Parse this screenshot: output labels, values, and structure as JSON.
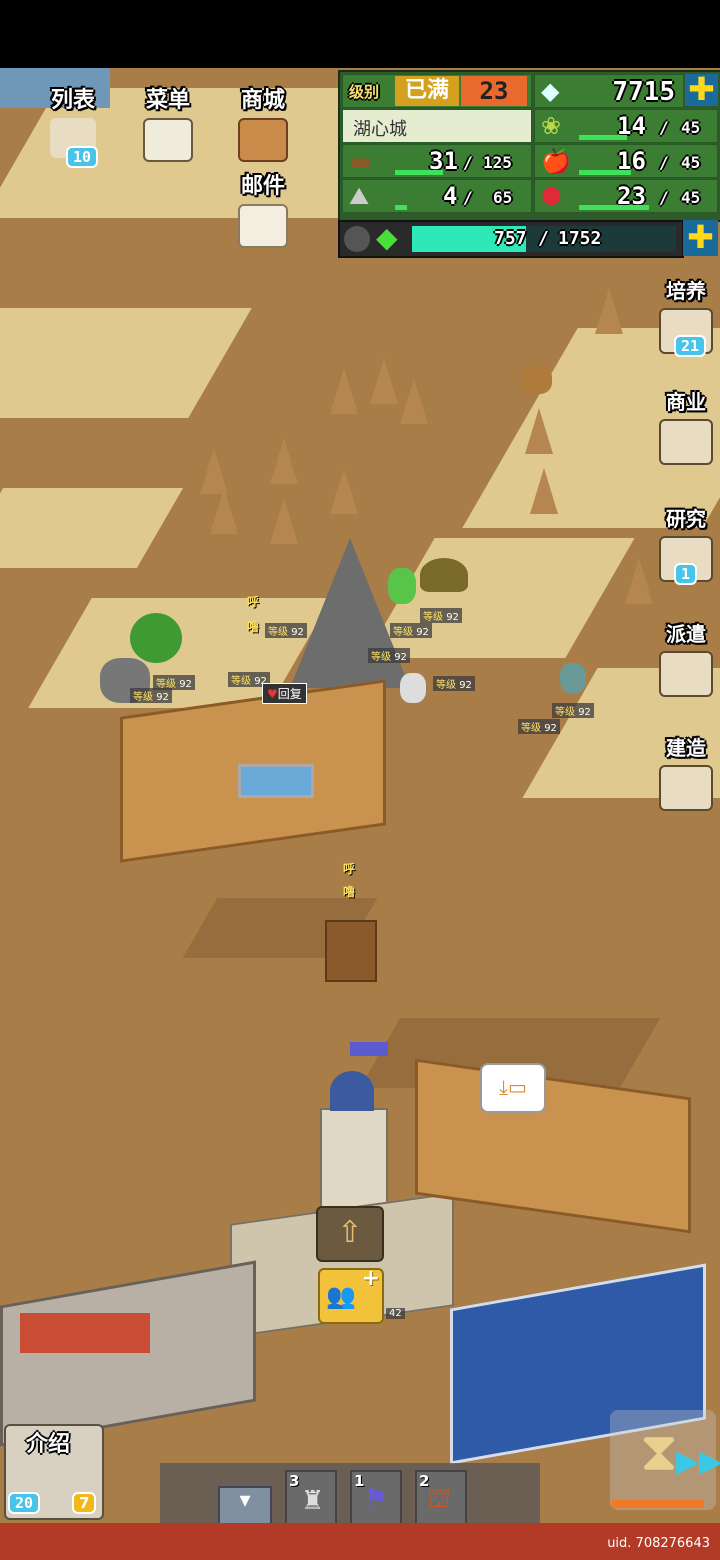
{
  "top_left_menu": {
    "list_label": "列表",
    "list_badge": "10",
    "menu_label": "菜单",
    "shop_label": "商城",
    "mail_label": "邮件"
  },
  "resources": {
    "level_label": "级别",
    "level_status": "已满",
    "level_value": "23",
    "gems": "7715",
    "town_name": "湖心城",
    "wood_current": "31",
    "wood_max": "125",
    "ore_current": "4",
    "ore_max": "65",
    "food_current": "14",
    "food_max": "45",
    "fruit_current": "16",
    "fruit_max": "45",
    "ruby_current": "23",
    "ruby_max": "45",
    "exp_current": "757",
    "exp_max": "1752",
    "separator": "/"
  },
  "right_menu": {
    "train_label": "培养",
    "train_badge": "21",
    "business_label": "商业",
    "research_label": "研究",
    "research_badge": "1",
    "dispatch_label": "派遣",
    "build_label": "建造"
  },
  "map": {
    "level_tag_label": "等级",
    "level_tag_value": "92",
    "recover_label": "回复",
    "sound_hu": "呼",
    "sound_lu": "噜"
  },
  "bottom": {
    "intro_label": "介绍",
    "intro_badge_left": "20",
    "intro_badge_right": "7",
    "slot1_count": "3",
    "slot2_count": "1",
    "slot3_count": "2",
    "building_level": "42",
    "uid": "uid. 708276643"
  },
  "colors": {
    "panel_green": "#3c7d34",
    "sand": "#e0c98e",
    "ground": "#a87d47",
    "bottom_bar": "#b23a26",
    "badge_blue": "#48c4e8"
  }
}
